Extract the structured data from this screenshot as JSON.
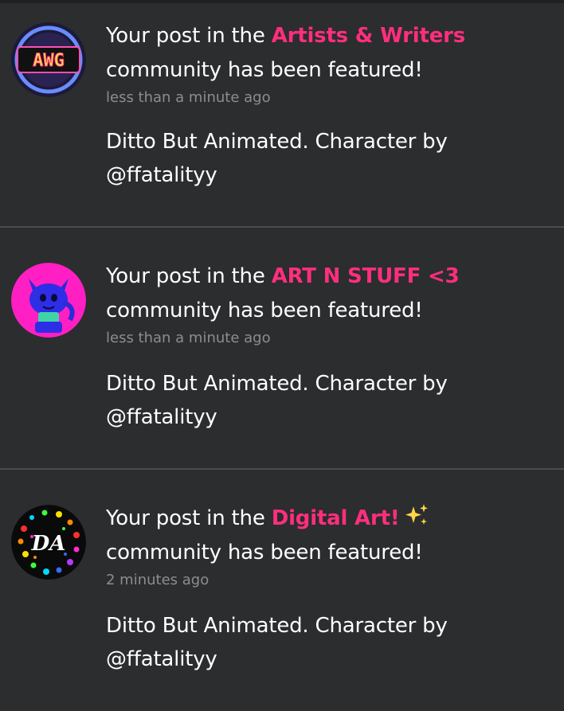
{
  "notifications": [
    {
      "prefix": "Your post in the ",
      "community": "Artists & Writers",
      "suffix": "community has been featured!",
      "time": "less than a minute ago",
      "caption_line1": "Ditto But Animated. Character by",
      "caption_line2": "@ffatalityy",
      "avatar_text": "AWG"
    },
    {
      "prefix": "Your post in the ",
      "community": "ART N STUFF <3",
      "suffix": "community has been featured!",
      "time": "less than a minute ago",
      "caption_line1": "Ditto But Animated. Character by",
      "caption_line2": "@ffatalityy"
    },
    {
      "prefix": "Your post in the ",
      "community": "Digital Art!",
      "suffix": "community has been featured!",
      "time": "2 minutes ago",
      "caption_line1": "Ditto But Animated. Character by",
      "caption_line2": "@ffatalityy",
      "avatar_text": "DA"
    }
  ],
  "colors": {
    "background": "#2b2d2e",
    "community_accent": "#ff2e7e",
    "timestamp": "#8b8e8f",
    "divider": "#4a4c4d"
  }
}
